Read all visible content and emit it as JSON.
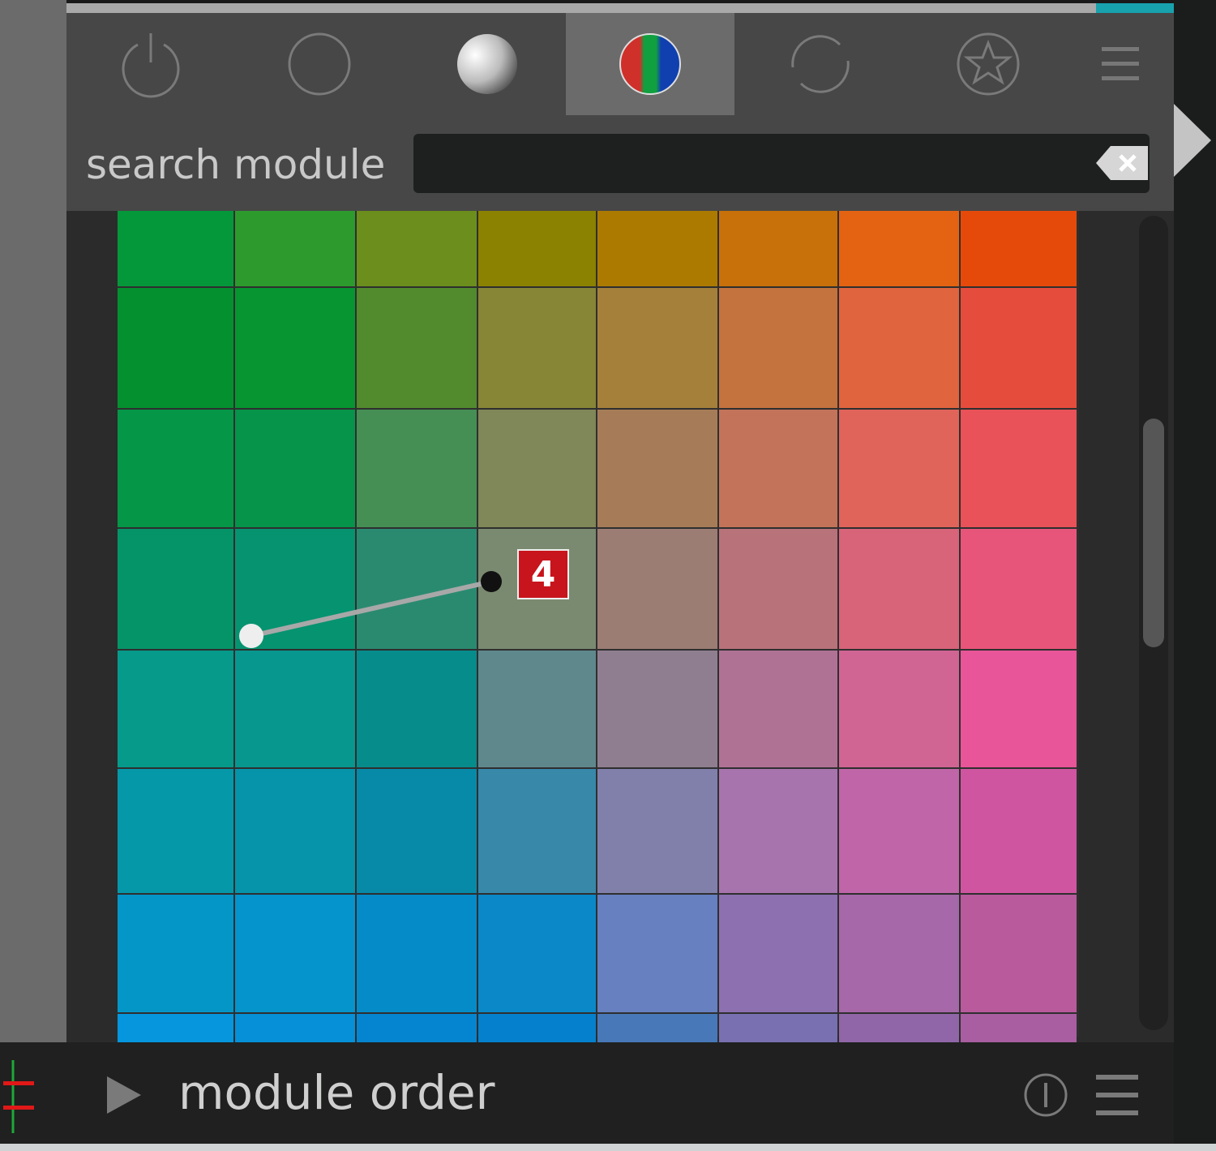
{
  "header": {
    "tabs": [
      {
        "name": "power-icon",
        "active": false
      },
      {
        "name": "circle-icon",
        "active": false
      },
      {
        "name": "sphere-icon",
        "active": false
      },
      {
        "name": "color-sphere-icon",
        "active": true
      },
      {
        "name": "refresh-icon",
        "active": false
      },
      {
        "name": "star-badge-icon",
        "active": false
      }
    ],
    "search_label": "search module",
    "search_value": "",
    "search_placeholder": ""
  },
  "colors": {
    "accent_teal": "#17a2ad",
    "badge_red": "#c8141c"
  },
  "color_grid": {
    "rows": [
      [
        "#05983a",
        "#2d9a2e",
        "#6b8e1d",
        "#8a8200",
        "#ad7a00",
        "#c8700a",
        "#e36312",
        "#e64a0a"
      ],
      [
        "#059030",
        "#069530",
        "#528a2e",
        "#878536",
        "#a4803a",
        "#c4723e",
        "#e0643e",
        "#e64c3c"
      ],
      [
        "#059648",
        "#05944a",
        "#458f55",
        "#808758",
        "#a67c58",
        "#c2735a",
        "#e0645a",
        "#e85258"
      ],
      [
        "#059468",
        "#069370",
        "#2a8a70",
        "#7a8a70",
        "#9c7d74",
        "#b8727a",
        "#d8647a",
        "#e8557a"
      ],
      [
        "#069a8a",
        "#07978e",
        "#078c8c",
        "#5e888c",
        "#8f7e90",
        "#b07294",
        "#d06594",
        "#e85598"
      ],
      [
        "#0598a8",
        "#0594aa",
        "#078aa8",
        "#3888aa",
        "#8080aa",
        "#a874ae",
        "#c065a8",
        "#d055a0"
      ],
      [
        "#0596c8",
        "#0594cc",
        "#058cc8",
        "#0a88c8",
        "#6680c0",
        "#8c70b0",
        "#a668a8",
        "#b85a9c"
      ],
      [
        "#0596de",
        "#0590d8",
        "#0585d0",
        "#0580cc",
        "#4878b8",
        "#7870b0",
        "#9066a8",
        "#a85ea0"
      ]
    ],
    "patch_badge": "4"
  },
  "bottom": {
    "module_label": "module order"
  }
}
